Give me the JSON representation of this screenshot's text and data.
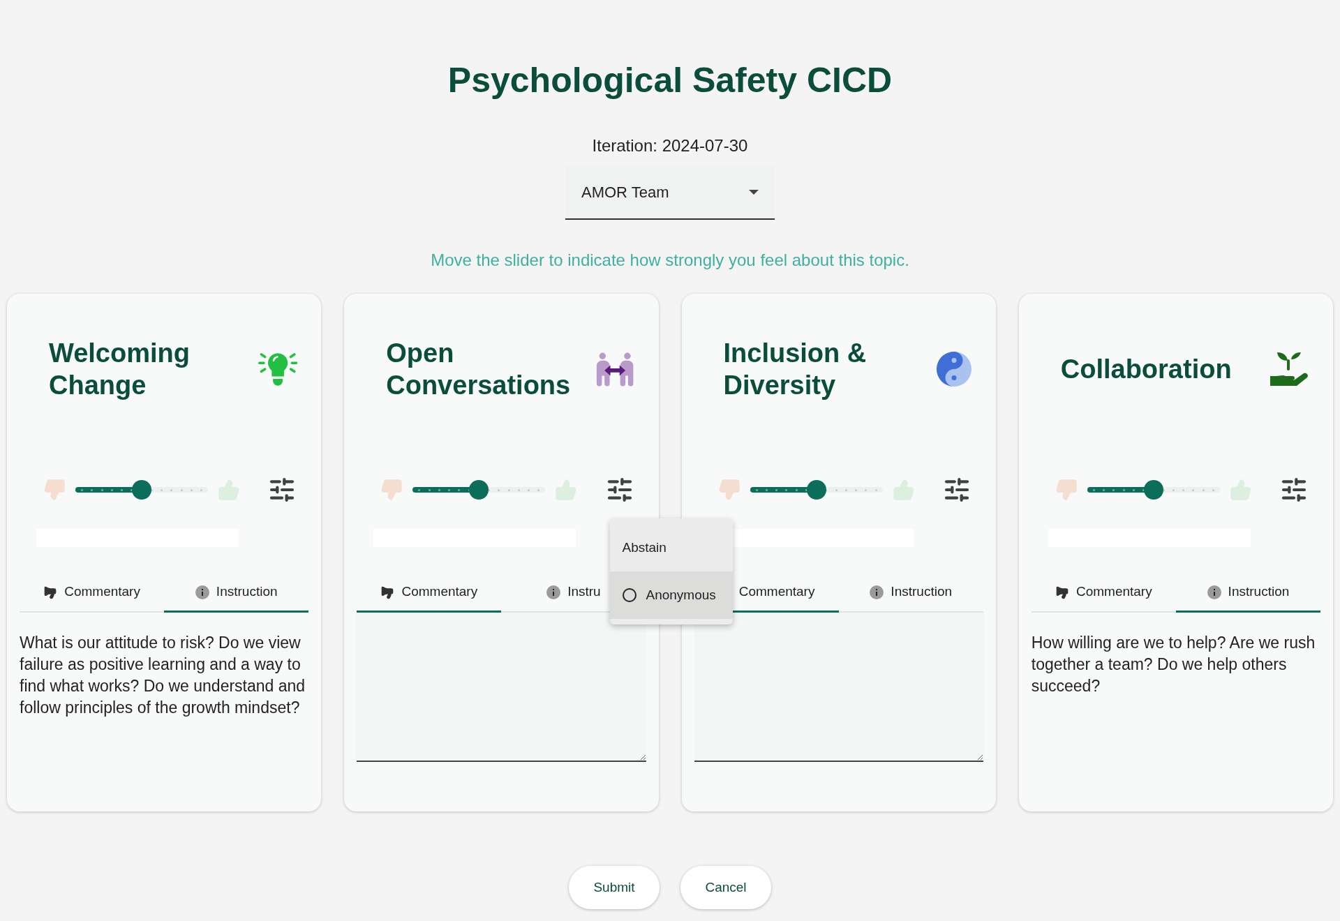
{
  "title": "Psychological Safety CICD",
  "iteration": "Iteration: 2024-07-30",
  "team_select": {
    "value": "AMOR Team"
  },
  "hint": "Move the slider to indicate how strongly you feel about this topic.",
  "cards": [
    {
      "title": "Welcoming Change",
      "level": 0.5,
      "tabs": [
        {
          "label": "Commentary",
          "kind": "commentary",
          "selected": false
        },
        {
          "label": "Instruction",
          "kind": "instruction",
          "selected": true
        }
      ],
      "panel": {
        "kind": "text",
        "text": "What is our attitude to risk? Do we view failure as positive learning and a way to find what works? Do we understand and follow principles of the growth mindset?"
      }
    },
    {
      "title": "Open Conversations",
      "level": 0.5,
      "tabs": [
        {
          "label": "Commentary",
          "kind": "commentary",
          "selected": true
        },
        {
          "label": "Instru",
          "kind": "instruction",
          "selected": false
        }
      ],
      "panel": {
        "kind": "comment"
      },
      "menu": [
        {
          "label": "Abstain",
          "kind": "plain",
          "highlighted": false
        },
        {
          "label": "Anonymous",
          "kind": "radio",
          "checked": false,
          "highlighted": true
        }
      ]
    },
    {
      "title": "Inclusion & Diversity",
      "level": 0.5,
      "tabs": [
        {
          "label": "Commentary",
          "kind": "commentary",
          "selected": true
        },
        {
          "label": "Instruction",
          "kind": "instruction",
          "selected": false
        }
      ],
      "panel": {
        "kind": "comment"
      }
    },
    {
      "title": "Collaboration",
      "level": 0.5,
      "tabs": [
        {
          "label": "Commentary",
          "kind": "commentary",
          "selected": false
        },
        {
          "label": "Instruction",
          "kind": "instruction",
          "selected": true
        }
      ],
      "panel": {
        "kind": "text",
        "text": "How willing are we to help? Are we rush together a team? Do we help others succeed?"
      }
    }
  ],
  "buttons": [
    {
      "label": "Submit"
    },
    {
      "label": "Cancel"
    }
  ]
}
